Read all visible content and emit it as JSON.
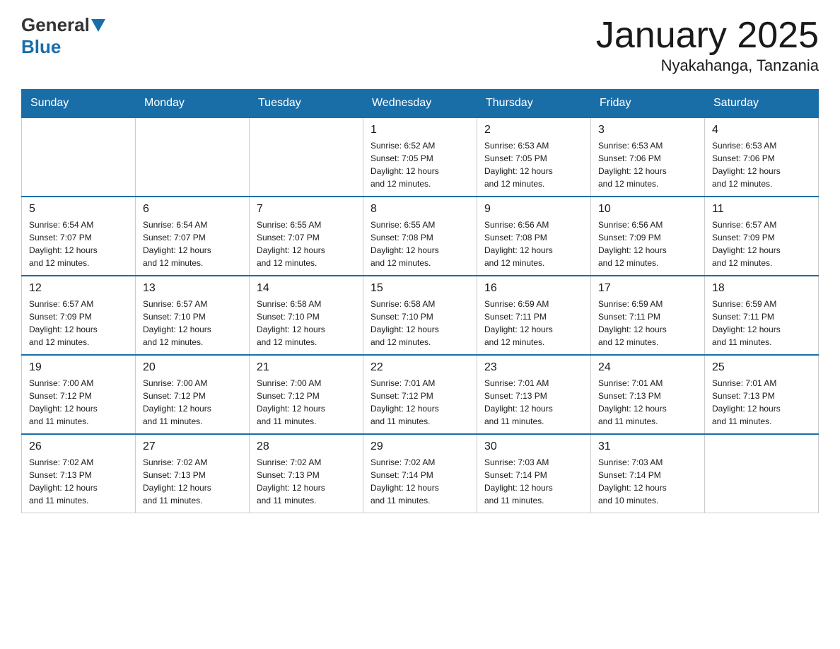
{
  "header": {
    "logo_general": "General",
    "logo_blue": "Blue",
    "title": "January 2025",
    "location": "Nyakahanga, Tanzania"
  },
  "days_of_week": [
    "Sunday",
    "Monday",
    "Tuesday",
    "Wednesday",
    "Thursday",
    "Friday",
    "Saturday"
  ],
  "weeks": [
    [
      {
        "day": "",
        "info": ""
      },
      {
        "day": "",
        "info": ""
      },
      {
        "day": "",
        "info": ""
      },
      {
        "day": "1",
        "info": "Sunrise: 6:52 AM\nSunset: 7:05 PM\nDaylight: 12 hours\nand 12 minutes."
      },
      {
        "day": "2",
        "info": "Sunrise: 6:53 AM\nSunset: 7:05 PM\nDaylight: 12 hours\nand 12 minutes."
      },
      {
        "day": "3",
        "info": "Sunrise: 6:53 AM\nSunset: 7:06 PM\nDaylight: 12 hours\nand 12 minutes."
      },
      {
        "day": "4",
        "info": "Sunrise: 6:53 AM\nSunset: 7:06 PM\nDaylight: 12 hours\nand 12 minutes."
      }
    ],
    [
      {
        "day": "5",
        "info": "Sunrise: 6:54 AM\nSunset: 7:07 PM\nDaylight: 12 hours\nand 12 minutes."
      },
      {
        "day": "6",
        "info": "Sunrise: 6:54 AM\nSunset: 7:07 PM\nDaylight: 12 hours\nand 12 minutes."
      },
      {
        "day": "7",
        "info": "Sunrise: 6:55 AM\nSunset: 7:07 PM\nDaylight: 12 hours\nand 12 minutes."
      },
      {
        "day": "8",
        "info": "Sunrise: 6:55 AM\nSunset: 7:08 PM\nDaylight: 12 hours\nand 12 minutes."
      },
      {
        "day": "9",
        "info": "Sunrise: 6:56 AM\nSunset: 7:08 PM\nDaylight: 12 hours\nand 12 minutes."
      },
      {
        "day": "10",
        "info": "Sunrise: 6:56 AM\nSunset: 7:09 PM\nDaylight: 12 hours\nand 12 minutes."
      },
      {
        "day": "11",
        "info": "Sunrise: 6:57 AM\nSunset: 7:09 PM\nDaylight: 12 hours\nand 12 minutes."
      }
    ],
    [
      {
        "day": "12",
        "info": "Sunrise: 6:57 AM\nSunset: 7:09 PM\nDaylight: 12 hours\nand 12 minutes."
      },
      {
        "day": "13",
        "info": "Sunrise: 6:57 AM\nSunset: 7:10 PM\nDaylight: 12 hours\nand 12 minutes."
      },
      {
        "day": "14",
        "info": "Sunrise: 6:58 AM\nSunset: 7:10 PM\nDaylight: 12 hours\nand 12 minutes."
      },
      {
        "day": "15",
        "info": "Sunrise: 6:58 AM\nSunset: 7:10 PM\nDaylight: 12 hours\nand 12 minutes."
      },
      {
        "day": "16",
        "info": "Sunrise: 6:59 AM\nSunset: 7:11 PM\nDaylight: 12 hours\nand 12 minutes."
      },
      {
        "day": "17",
        "info": "Sunrise: 6:59 AM\nSunset: 7:11 PM\nDaylight: 12 hours\nand 12 minutes."
      },
      {
        "day": "18",
        "info": "Sunrise: 6:59 AM\nSunset: 7:11 PM\nDaylight: 12 hours\nand 11 minutes."
      }
    ],
    [
      {
        "day": "19",
        "info": "Sunrise: 7:00 AM\nSunset: 7:12 PM\nDaylight: 12 hours\nand 11 minutes."
      },
      {
        "day": "20",
        "info": "Sunrise: 7:00 AM\nSunset: 7:12 PM\nDaylight: 12 hours\nand 11 minutes."
      },
      {
        "day": "21",
        "info": "Sunrise: 7:00 AM\nSunset: 7:12 PM\nDaylight: 12 hours\nand 11 minutes."
      },
      {
        "day": "22",
        "info": "Sunrise: 7:01 AM\nSunset: 7:12 PM\nDaylight: 12 hours\nand 11 minutes."
      },
      {
        "day": "23",
        "info": "Sunrise: 7:01 AM\nSunset: 7:13 PM\nDaylight: 12 hours\nand 11 minutes."
      },
      {
        "day": "24",
        "info": "Sunrise: 7:01 AM\nSunset: 7:13 PM\nDaylight: 12 hours\nand 11 minutes."
      },
      {
        "day": "25",
        "info": "Sunrise: 7:01 AM\nSunset: 7:13 PM\nDaylight: 12 hours\nand 11 minutes."
      }
    ],
    [
      {
        "day": "26",
        "info": "Sunrise: 7:02 AM\nSunset: 7:13 PM\nDaylight: 12 hours\nand 11 minutes."
      },
      {
        "day": "27",
        "info": "Sunrise: 7:02 AM\nSunset: 7:13 PM\nDaylight: 12 hours\nand 11 minutes."
      },
      {
        "day": "28",
        "info": "Sunrise: 7:02 AM\nSunset: 7:13 PM\nDaylight: 12 hours\nand 11 minutes."
      },
      {
        "day": "29",
        "info": "Sunrise: 7:02 AM\nSunset: 7:14 PM\nDaylight: 12 hours\nand 11 minutes."
      },
      {
        "day": "30",
        "info": "Sunrise: 7:03 AM\nSunset: 7:14 PM\nDaylight: 12 hours\nand 11 minutes."
      },
      {
        "day": "31",
        "info": "Sunrise: 7:03 AM\nSunset: 7:14 PM\nDaylight: 12 hours\nand 10 minutes."
      },
      {
        "day": "",
        "info": ""
      }
    ]
  ]
}
